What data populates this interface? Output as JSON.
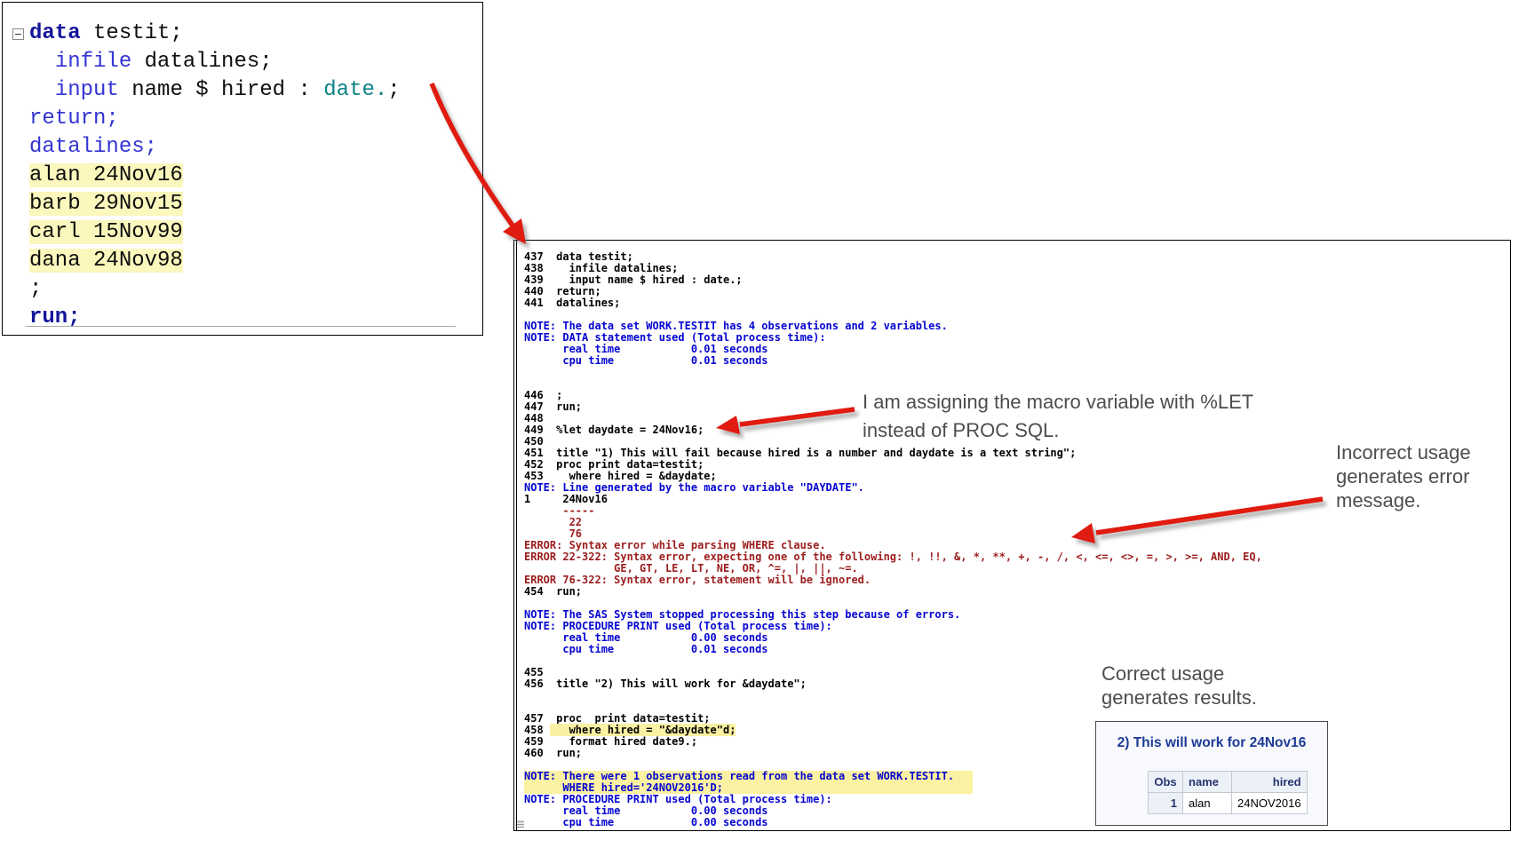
{
  "editor": {
    "lines": [
      {
        "parts": [
          {
            "t": "data",
            "c": "kw"
          },
          {
            "t": " testit;",
            "c": "pl"
          }
        ]
      },
      {
        "parts": [
          {
            "t": "  ",
            "c": "pl"
          },
          {
            "t": "infile",
            "c": "kw2"
          },
          {
            "t": " datalines;",
            "c": "pl"
          }
        ]
      },
      {
        "parts": [
          {
            "t": "  ",
            "c": "pl"
          },
          {
            "t": "input",
            "c": "kw2"
          },
          {
            "t": " name $ hired : ",
            "c": "pl"
          },
          {
            "t": "date.",
            "c": "fmt"
          },
          {
            "t": ";",
            "c": "pl"
          }
        ]
      },
      {
        "parts": [
          {
            "t": "return;",
            "c": "kw2"
          }
        ]
      },
      {
        "parts": [
          {
            "t": "datalines;",
            "c": "kw2"
          }
        ]
      },
      {
        "parts": [
          {
            "t": "alan 24Nov16",
            "c": "pl",
            "hl": true
          }
        ]
      },
      {
        "parts": [
          {
            "t": "barb 29Nov15",
            "c": "pl",
            "hl": true
          }
        ]
      },
      {
        "parts": [
          {
            "t": "carl 15Nov99",
            "c": "pl",
            "hl": true
          }
        ]
      },
      {
        "parts": [
          {
            "t": "dana 24Nov98",
            "c": "pl",
            "hl": true
          }
        ]
      },
      {
        "parts": [
          {
            "t": ";",
            "c": "pl"
          }
        ]
      },
      {
        "parts": [
          {
            "t": "run;",
            "c": "kw"
          }
        ]
      }
    ]
  },
  "log": {
    "lines": [
      {
        "t": "437  data testit;",
        "c": "code"
      },
      {
        "t": "438    infile datalines;",
        "c": "code"
      },
      {
        "t": "439    input name $ hired : date.;",
        "c": "code"
      },
      {
        "t": "440  return;",
        "c": "code"
      },
      {
        "t": "441  datalines;",
        "c": "code"
      },
      {
        "t": "",
        "c": "code"
      },
      {
        "t": "NOTE: The data set WORK.TESTIT has 4 observations and 2 variables.",
        "c": "note"
      },
      {
        "t": "NOTE: DATA statement used (Total process time):",
        "c": "note"
      },
      {
        "t": "      real time           0.01 seconds",
        "c": "note"
      },
      {
        "t": "      cpu time            0.01 seconds",
        "c": "note"
      },
      {
        "t": "",
        "c": "code"
      },
      {
        "t": "",
        "c": "code"
      },
      {
        "t": "446  ;",
        "c": "code"
      },
      {
        "t": "447  run;",
        "c": "code"
      },
      {
        "t": "448",
        "c": "code"
      },
      {
        "t": "449  %let daydate = 24Nov16;",
        "c": "code"
      },
      {
        "t": "450",
        "c": "code"
      },
      {
        "t": "451  title \"1) This will fail because hired is a number and daydate is a text string\";",
        "c": "code"
      },
      {
        "t": "452  proc print data=testit;",
        "c": "code"
      },
      {
        "t": "453    where hired = &daydate;",
        "c": "code"
      },
      {
        "t": "NOTE: Line generated by the macro variable \"DAYDATE\".",
        "c": "note"
      },
      {
        "t": "1     24Nov16",
        "c": "code"
      },
      {
        "t": "      -----",
        "c": "error"
      },
      {
        "t": "       22",
        "c": "error"
      },
      {
        "t": "       76",
        "c": "error"
      },
      {
        "t": "ERROR: Syntax error while parsing WHERE clause.",
        "c": "error"
      },
      {
        "t": "ERROR 22-322: Syntax error, expecting one of the following: !, !!, &, *, **, +, -, /, <, <=, <>, =, >, >=, AND, EQ,",
        "c": "error"
      },
      {
        "t": "              GE, GT, LE, LT, NE, OR, ^=, |, ||, ~=.",
        "c": "error"
      },
      {
        "t": "ERROR 76-322: Syntax error, statement will be ignored.",
        "c": "error"
      },
      {
        "t": "454  run;",
        "c": "code"
      },
      {
        "t": "",
        "c": "code"
      },
      {
        "t": "NOTE: The SAS System stopped processing this step because of errors.",
        "c": "note"
      },
      {
        "t": "NOTE: PROCEDURE PRINT used (Total process time):",
        "c": "note"
      },
      {
        "t": "      real time           0.00 seconds",
        "c": "note"
      },
      {
        "t": "      cpu time            0.01 seconds",
        "c": "note"
      },
      {
        "t": "",
        "c": "code"
      },
      {
        "t": "455",
        "c": "code"
      },
      {
        "t": "456  title \"2) This will work for &daydate\";",
        "c": "code"
      },
      {
        "t": "",
        "c": "code"
      },
      {
        "t": "",
        "c": "code"
      },
      {
        "t": "457  proc  print data=testit;",
        "c": "code"
      },
      {
        "pre": "458 ",
        "t": "   where hired = \"&daydate\"d;",
        "c": "code",
        "hl": true
      },
      {
        "t": "459    format hired date9.;",
        "c": "code"
      },
      {
        "t": "460  run;",
        "c": "code"
      },
      {
        "t": "",
        "c": "code"
      },
      {
        "t": "NOTE: There were 1 observations read from the data set WORK.TESTIT.",
        "c": "note",
        "hl": true,
        "blk": true
      },
      {
        "t": "      WHERE hired='24NOV2016'D;",
        "c": "note",
        "hl": true,
        "blk": true
      },
      {
        "t": "NOTE: PROCEDURE PRINT used (Total process time):",
        "c": "note"
      },
      {
        "t": "      real time           0.00 seconds",
        "c": "note"
      },
      {
        "t": "      cpu time            0.00 seconds",
        "c": "note"
      }
    ]
  },
  "annotations": {
    "let": [
      "I am assigning the macro variable with %LET",
      "instead of PROC SQL."
    ],
    "error": [
      "Incorrect usage",
      "generates error",
      "message."
    ],
    "correct": [
      "Correct usage",
      "generates results."
    ]
  },
  "results": {
    "title": "2) This will work for 24Nov16",
    "table": {
      "headers": [
        "Obs",
        "name",
        "hired"
      ],
      "rows": [
        [
          "1",
          "alan",
          "24NOV2016"
        ]
      ]
    }
  },
  "colors": {
    "editor_keyword_navy": "#15159b",
    "editor_keyword_blue": "#3434d4",
    "editor_format_teal": "#0e8285",
    "editor_highlight_yellow": "#fbf7bd",
    "log_note_blue": "#0505d0",
    "log_error_maroon": "#9b1d1d",
    "log_highlight_yellow": "#faf1a2",
    "arrow_red": "#e01b10",
    "annotation_gray": "#4d4d4d",
    "results_title_navy": "#1e3a96",
    "results_header_bg": "#ecf1f8"
  }
}
